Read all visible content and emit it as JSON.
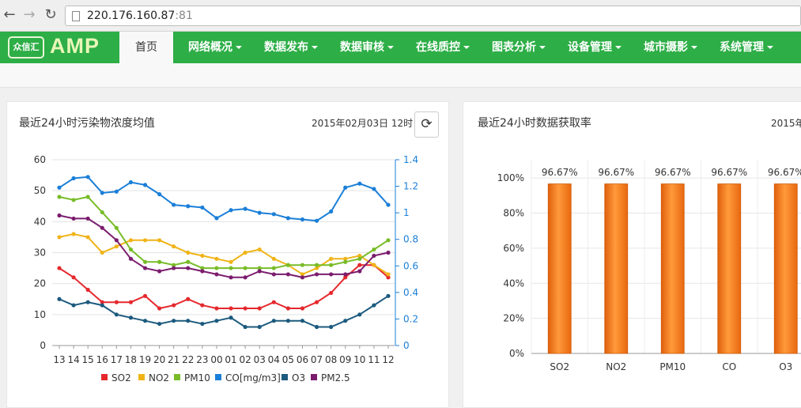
{
  "browser": {
    "url_host": "220.176.160.87",
    "url_port": ":81"
  },
  "app": {
    "logo_badge": "众信汇",
    "logo_text": "AMP",
    "colors": {
      "nav_bg": "#2dae46",
      "active_tab_bg": "#f8f8f8"
    }
  },
  "nav": {
    "tabs": [
      {
        "label": "首页",
        "dropdown": false,
        "active": true
      },
      {
        "label": "网络概况",
        "dropdown": true,
        "active": false
      },
      {
        "label": "数据发布",
        "dropdown": true,
        "active": false
      },
      {
        "label": "数据审核",
        "dropdown": true,
        "active": false
      },
      {
        "label": "在线质控",
        "dropdown": true,
        "active": false
      },
      {
        "label": "图表分析",
        "dropdown": true,
        "active": false
      },
      {
        "label": "设备管理",
        "dropdown": true,
        "active": false
      },
      {
        "label": "城市摄影",
        "dropdown": true,
        "active": false
      },
      {
        "label": "系统管理",
        "dropdown": true,
        "active": false
      }
    ]
  },
  "panels": {
    "left": {
      "title": "最近24小时污染物浓度均值",
      "time": "2015年02月03日 12时",
      "refresh_icon": "refresh-icon"
    },
    "right": {
      "title": "最近24小时数据获取率",
      "time": "2015年"
    }
  },
  "chart_data": [
    {
      "type": "line",
      "x": [
        "13",
        "14",
        "15",
        "16",
        "17",
        "18",
        "19",
        "20",
        "21",
        "22",
        "23",
        "00",
        "01",
        "02",
        "03",
        "04",
        "05",
        "06",
        "07",
        "08",
        "09",
        "10",
        "11",
        "12"
      ],
      "ylim": [
        0,
        60
      ],
      "y2lim": [
        0,
        1.4
      ],
      "yticks": [
        "0",
        "10",
        "20",
        "30",
        "40",
        "50",
        "60"
      ],
      "y2ticks": [
        "0",
        "0.2",
        "0.4",
        "0.6",
        "0.8",
        "1",
        "1.2",
        "1.4"
      ],
      "legend_position": "bottom",
      "series": [
        {
          "name": "SO2",
          "color": "#e5282d",
          "axis": "left",
          "values": [
            25,
            22,
            18,
            14,
            14,
            14,
            16,
            12,
            13,
            15,
            13,
            12,
            12,
            12,
            12,
            14,
            12,
            12,
            14,
            17,
            22,
            26,
            26,
            22
          ]
        },
        {
          "name": "NO2",
          "color": "#f0b418",
          "axis": "left",
          "values": [
            35,
            36,
            35,
            30,
            32,
            34,
            34,
            34,
            32,
            30,
            29,
            28,
            27,
            30,
            31,
            28,
            26,
            23,
            25,
            28,
            28,
            29,
            26,
            23
          ]
        },
        {
          "name": "PM10",
          "color": "#78bc28",
          "axis": "left",
          "values": [
            48,
            47,
            48,
            43,
            38,
            31,
            27,
            27,
            26,
            27,
            25,
            25,
            25,
            25,
            25,
            25,
            26,
            26,
            26,
            26,
            27,
            28,
            31,
            34
          ]
        },
        {
          "name": "CO[mg/m3]",
          "color": "#1a7fd8",
          "axis": "right",
          "values": [
            1.19,
            1.26,
            1.27,
            1.15,
            1.16,
            1.23,
            1.21,
            1.14,
            1.06,
            1.05,
            1.04,
            0.96,
            1.02,
            1.03,
            1.0,
            0.99,
            0.96,
            0.95,
            0.94,
            1.01,
            1.19,
            1.22,
            1.18,
            1.06
          ]
        },
        {
          "name": "O3",
          "color": "#1c5a7e",
          "axis": "left",
          "values": [
            15,
            13,
            14,
            13,
            10,
            9,
            8,
            7,
            8,
            8,
            7,
            8,
            9,
            6,
            6,
            8,
            8,
            8,
            6,
            6,
            8,
            10,
            13,
            16
          ]
        },
        {
          "name": "PM2.5",
          "color": "#7b1c6e",
          "axis": "left",
          "values": [
            42,
            41,
            41,
            38,
            34,
            28,
            25,
            24,
            25,
            25,
            24,
            23,
            22,
            22,
            24,
            23,
            23,
            22,
            23,
            23,
            23,
            24,
            29,
            30
          ]
        }
      ]
    },
    {
      "type": "bar",
      "categories": [
        "SO2",
        "NO2",
        "PM10",
        "CO",
        "O3"
      ],
      "values": [
        96.67,
        96.67,
        96.67,
        96.67,
        96.67
      ],
      "labels": [
        "96.67%",
        "96.67%",
        "96.67%",
        "96.67%",
        "96.67%"
      ],
      "ylim": [
        0,
        110
      ],
      "yticks": [
        "0%",
        "20%",
        "40%",
        "60%",
        "80%",
        "100%"
      ],
      "color": "#f07a1a"
    }
  ]
}
